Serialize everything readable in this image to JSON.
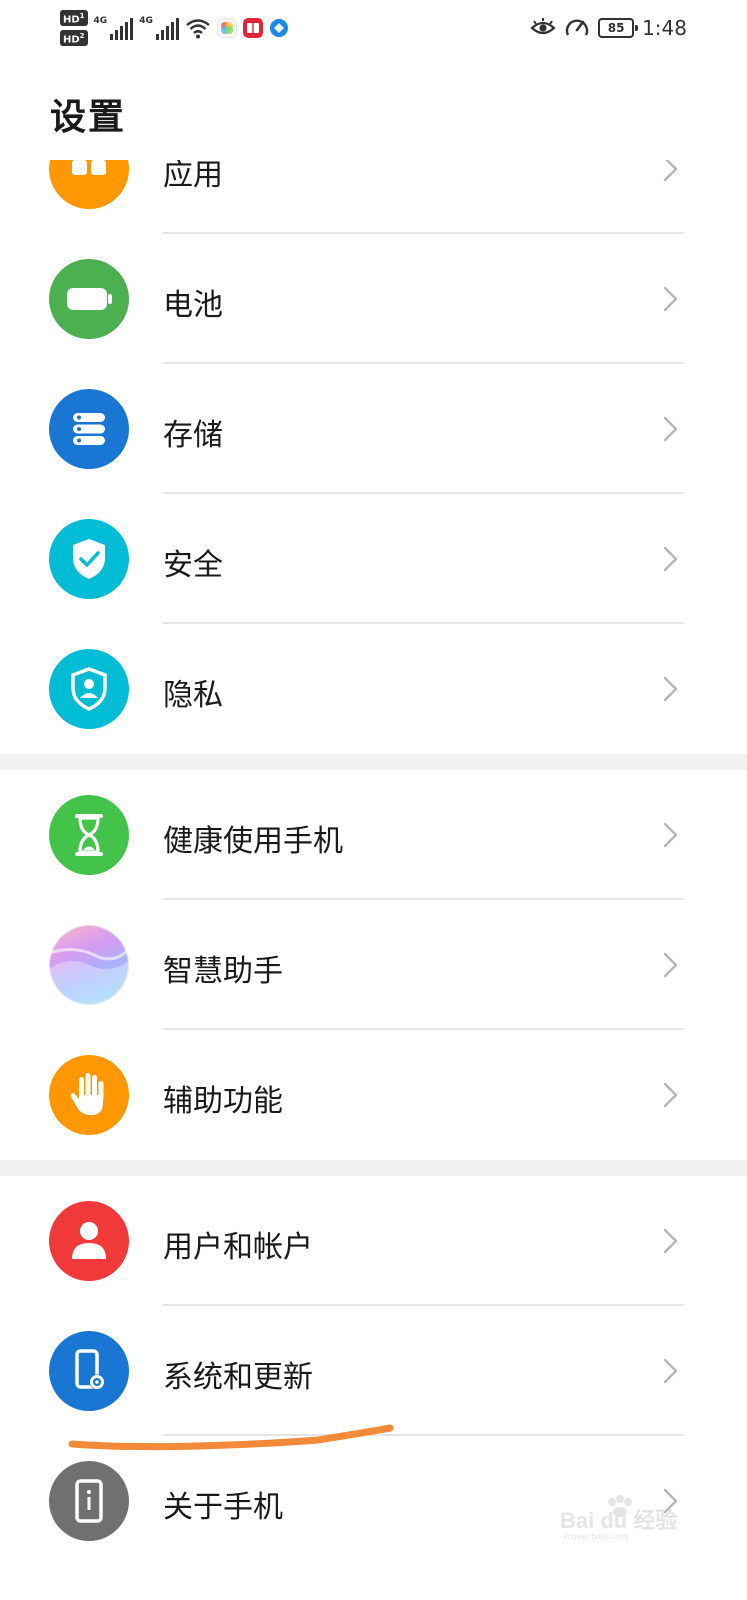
{
  "status_bar": {
    "sim1": "HD",
    "sim1_index": "1",
    "sim2": "HD",
    "sim2_index": "2",
    "network1": "4G",
    "network2": "4G",
    "battery_level": "85",
    "time": "1:48"
  },
  "header": {
    "title": "设置"
  },
  "rows": [
    {
      "label": "应用",
      "icon": "apps-icon",
      "color": "#ff9800"
    },
    {
      "label": "电池",
      "icon": "battery-icon",
      "color": "#4caf50"
    },
    {
      "label": "存储",
      "icon": "storage-icon",
      "color": "#1976d2"
    },
    {
      "label": "安全",
      "icon": "shield-check-icon",
      "color": "#00bcd4"
    },
    {
      "label": "隐私",
      "icon": "privacy-shield-icon",
      "color": "#00bcd4"
    },
    {
      "label": "健康使用手机",
      "icon": "hourglass-icon",
      "color": "#43c34a"
    },
    {
      "label": "智慧助手",
      "icon": "assistant-orb-icon",
      "color": "#c8a5f0"
    },
    {
      "label": "辅助功能",
      "icon": "hand-icon",
      "color": "#ff9800"
    },
    {
      "label": "用户和帐户",
      "icon": "user-icon",
      "color": "#f03a3a"
    },
    {
      "label": "系统和更新",
      "icon": "phone-settings-icon",
      "color": "#1976d2"
    },
    {
      "label": "关于手机",
      "icon": "phone-info-icon",
      "color": "#707070"
    }
  ],
  "watermark": {
    "text": "Bai du 经验",
    "sub": "jingyan.baidu.com"
  }
}
